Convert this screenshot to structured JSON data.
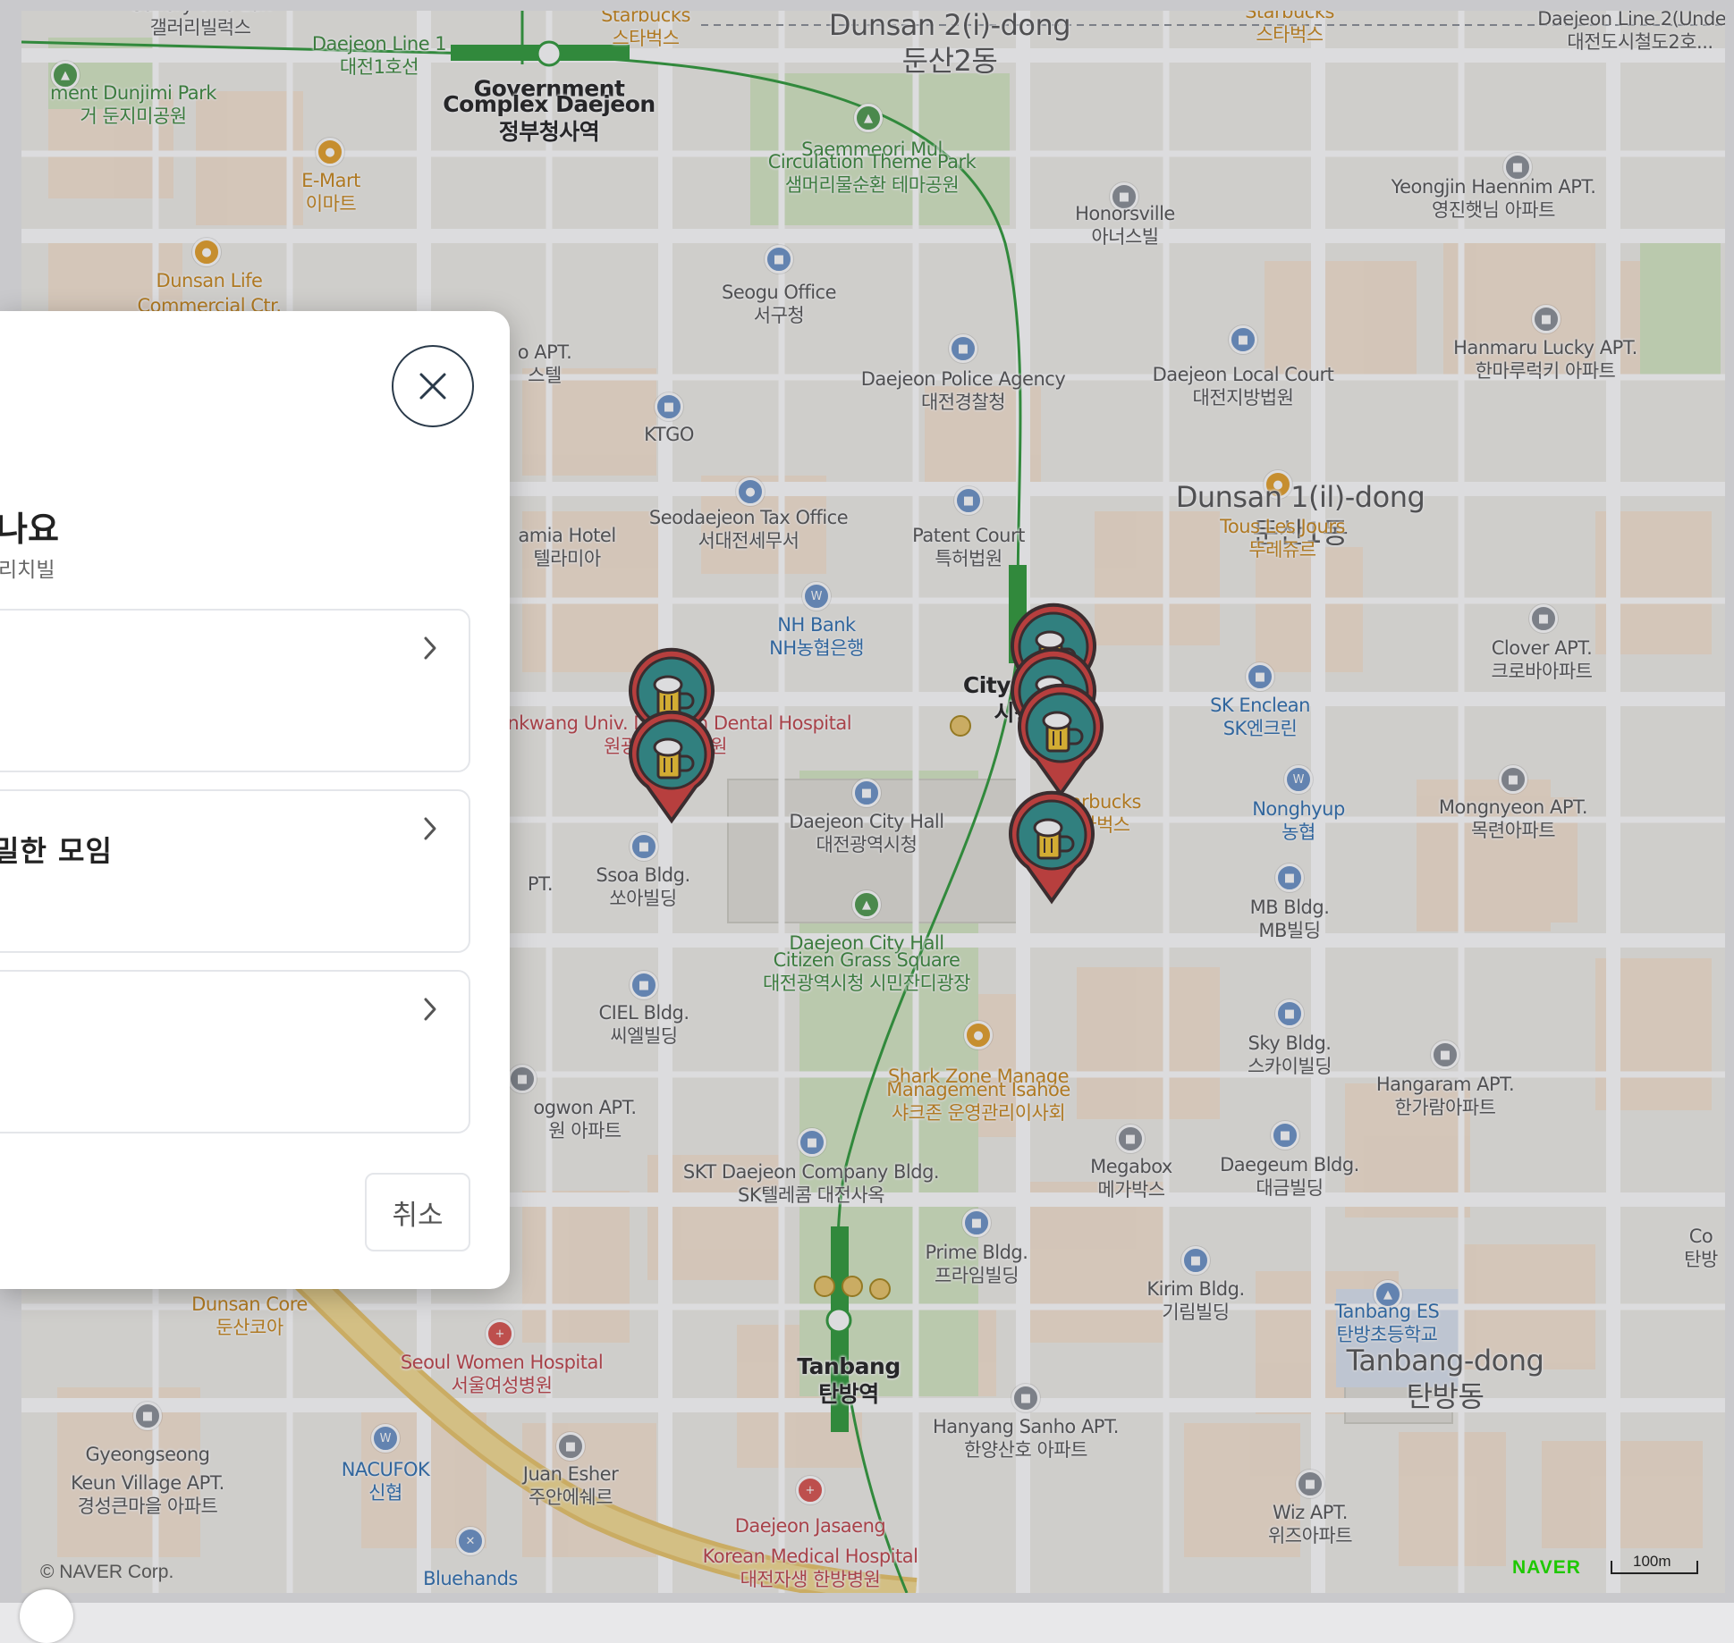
{
  "map": {
    "labels": [
      {
        "text": "Gallery ville Lux",
        "sub": "갤러리빌럭스",
        "cls": ""
      },
      {
        "text": "Starbucks",
        "sub": "스타벅스",
        "cls": "orange"
      },
      {
        "text": "Daejeon Line 1",
        "sub": "대전1호선",
        "cls": "green"
      },
      {
        "text": "Government",
        "sub": "",
        "cls": "station"
      },
      {
        "text": "Complex Daejeon",
        "sub": "정부청사역",
        "cls": "station"
      },
      {
        "text": "Dunsan 2(i)-dong",
        "sub": "둔산2동",
        "cls": "big"
      },
      {
        "text": "Starbucks",
        "sub": "스타벅스",
        "cls": "orange"
      },
      {
        "text": "Daejeon Line 2(Unde...",
        "sub": "대전도시철도2호...",
        "cls": ""
      },
      {
        "text": "ment Dunjimi Park",
        "sub": "거 둔지미공원",
        "cls": "green"
      },
      {
        "text": "E-Mart",
        "sub": "이마트",
        "cls": "orange"
      },
      {
        "text": "Saemmeori Mul",
        "sub": "",
        "cls": "green"
      },
      {
        "text": "Circulation Theme Park",
        "sub": "샘머리물순환 테마공원",
        "cls": "green"
      },
      {
        "text": "Yeongjin Haennim APT.",
        "sub": "영진햇님 아파트",
        "cls": ""
      },
      {
        "text": "Honorsville",
        "sub": "아너스빌",
        "cls": ""
      },
      {
        "text": "Dunsan Life",
        "sub": "",
        "cls": "orange"
      },
      {
        "text": "Commercial Ctr.",
        "sub": "",
        "cls": "orange"
      },
      {
        "text": "Seogu Office",
        "sub": "서구청",
        "cls": ""
      },
      {
        "text": "o APT.",
        "sub": "스텔",
        "cls": ""
      },
      {
        "text": "Daejeon Police Agency",
        "sub": "대전경찰청",
        "cls": ""
      },
      {
        "text": "Daejeon Local Court",
        "sub": "대전지방법원",
        "cls": ""
      },
      {
        "text": "Hanmaru Lucky APT.",
        "sub": "한마루럭키 아파트",
        "cls": ""
      },
      {
        "text": "KTGO",
        "sub": "",
        "cls": ""
      },
      {
        "text": "Seodaejeon Tax Office",
        "sub": "서대전세무서",
        "cls": ""
      },
      {
        "text": "Patent Court",
        "sub": "특허법원",
        "cls": ""
      },
      {
        "text": "Dunsan 1(il)-dong",
        "sub": "둔산1동",
        "cls": "big"
      },
      {
        "text": "Tous Les Jours",
        "sub": "뚜레쥬르",
        "cls": "orange"
      },
      {
        "text": "amia Hotel",
        "sub": "텔라미아",
        "cls": ""
      },
      {
        "text": "NH Bank",
        "sub": "NH농협은행",
        "cls": "blue"
      },
      {
        "text": "Clover APT.",
        "sub": "크로바아파트",
        "cls": ""
      },
      {
        "text": "SK Enclean",
        "sub": "SK엔크린",
        "cls": "blue"
      },
      {
        "text": "Wonkwang Univ. Daejeon Dental Hospital",
        "sub": "원광대 치과병원",
        "cls": "red"
      },
      {
        "text": "City Hall",
        "sub": "시청",
        "cls": "station"
      },
      {
        "text": "Nonghyup",
        "sub": "농협",
        "cls": "blue"
      },
      {
        "text": "Mongnyeon APT.",
        "sub": "목련아파트",
        "cls": ""
      },
      {
        "text": "Starbucks",
        "sub": "스타벅스",
        "cls": "orange"
      },
      {
        "text": "Daejeon City Hall",
        "sub": "대전광역시청",
        "cls": ""
      },
      {
        "text": "Ssoa Bldg.",
        "sub": "쏘아빌딩",
        "cls": ""
      },
      {
        "text": "MB Bldg.",
        "sub": "MB빌딩",
        "cls": ""
      },
      {
        "text": "PT.",
        "sub": "",
        "cls": ""
      },
      {
        "text": "Daejeon City Hall",
        "sub": "",
        "cls": "green"
      },
      {
        "text": "Citizen Grass Square",
        "sub": "대전광역시청 시민잔디광장",
        "cls": "green"
      },
      {
        "text": "CIEL Bldg.",
        "sub": "씨엘빌딩",
        "cls": ""
      },
      {
        "text": "Sky Bldg.",
        "sub": "스카이빌딩",
        "cls": ""
      },
      {
        "text": "Hangaram APT.",
        "sub": "한가람아파트",
        "cls": ""
      },
      {
        "text": "Shark Zone Manage",
        "sub": "",
        "cls": "orange"
      },
      {
        "text": "Management Isahoe",
        "sub": "샤크존 운영관리이사회",
        "cls": "orange"
      },
      {
        "text": "ogwon APT.",
        "sub": "원 아파트",
        "cls": ""
      },
      {
        "text": "Megabox",
        "sub": "메가박스",
        "cls": ""
      },
      {
        "text": "Daegeum Bldg.",
        "sub": "대금빌딩",
        "cls": ""
      },
      {
        "text": "SKT Daejeon Company Bldg.",
        "sub": "SK텔레콤 대전사옥",
        "cls": ""
      },
      {
        "text": "Prime Bldg.",
        "sub": "프라임빌딩",
        "cls": ""
      },
      {
        "text": "Kirim Bldg.",
        "sub": "기림빌딩",
        "cls": ""
      },
      {
        "text": "Co",
        "sub": "탄방",
        "cls": ""
      },
      {
        "text": "Dunsan Core",
        "sub": "둔산코아",
        "cls": "orange"
      },
      {
        "text": "Tanbang",
        "sub": "탄방역",
        "cls": "station"
      },
      {
        "text": "Tanbang ES",
        "sub": "탄방초등학교",
        "cls": "blue"
      },
      {
        "text": "Tanbang-dong",
        "sub": "탄방동",
        "cls": "big"
      },
      {
        "text": "Seoul Women Hospital",
        "sub": "서울여성병원",
        "cls": "red"
      },
      {
        "text": "Gyeongseong",
        "sub": "",
        "cls": ""
      },
      {
        "text": "Keun Village APT.",
        "sub": "경성큰마을 아파트",
        "cls": ""
      },
      {
        "text": "NACUFOK",
        "sub": "신협",
        "cls": "blue"
      },
      {
        "text": "Juan Esher",
        "sub": "주안에쉐르",
        "cls": ""
      },
      {
        "text": "Hanyang Sanho APT.",
        "sub": "한양산호 아파트",
        "cls": ""
      },
      {
        "text": "Wiz APT.",
        "sub": "위즈아파트",
        "cls": ""
      },
      {
        "text": "Daejeon Jasaeng",
        "sub": "",
        "cls": "red"
      },
      {
        "text": "Korean Medical Hospital",
        "sub": "대전자생 한방병원",
        "cls": "red"
      },
      {
        "text": "Bluehands",
        "sub": "",
        "cls": "blue"
      }
    ],
    "copyright": "© NAVER Corp.",
    "brand": "NAVER",
    "scale": "100m"
  },
  "dialog": {
    "title": "나요",
    "subtitle": "리치빌",
    "options": [
      {
        "label": ""
      },
      {
        "label": "밀한 모임"
      },
      {
        "label": ""
      }
    ],
    "cancel_label": "취소"
  },
  "colors": {
    "pin_red": "#d2403c",
    "pin_teal": "#2f8f8c",
    "beer_yellow": "#f3c52f",
    "subway_green": "#2f9a3a",
    "road_orange": "#e9c56a"
  },
  "icons": {
    "close": "close-icon",
    "chevron": "chevron-right-icon",
    "pin": "beer-pin-icon"
  }
}
